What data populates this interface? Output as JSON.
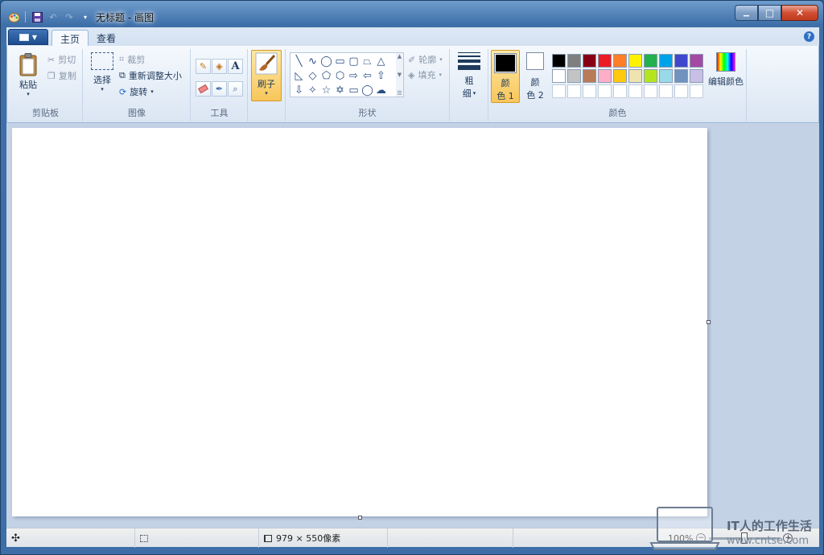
{
  "window": {
    "title": "无标题 - 画图"
  },
  "caption_buttons": {
    "minimize": "▁",
    "maximize": "□",
    "close": "✕"
  },
  "tabs": [
    {
      "label": "主页",
      "active": true
    },
    {
      "label": "查看",
      "active": false
    }
  ],
  "clipboard": {
    "paste": "粘贴",
    "cut": "剪切",
    "copy": "复制",
    "group": "剪贴板"
  },
  "image": {
    "select": "选择",
    "crop": "裁剪",
    "resize": "重新调整大小",
    "rotate": "旋转",
    "group": "图像"
  },
  "tools": {
    "group": "工具",
    "text_glyph": "A"
  },
  "brushes": {
    "label": "刷子"
  },
  "shapes": {
    "outline": "轮廓",
    "fill": "填充",
    "group": "形状"
  },
  "size": {
    "line1": "粗",
    "line2": "细"
  },
  "colors": {
    "color1_l1": "颜",
    "color1_l2": "色 1",
    "color2_l1": "颜",
    "color2_l2": "色 2",
    "edit": "编辑颜色",
    "group": "颜色",
    "color1": "#000000",
    "color2": "#ffffff",
    "palette": [
      "#000000",
      "#7f7f7f",
      "#880015",
      "#ed1c24",
      "#ff7f27",
      "#fff200",
      "#22b14c",
      "#00a2e8",
      "#3f48cc",
      "#a349a4",
      "#ffffff",
      "#c3c3c3",
      "#b97a57",
      "#ffaec9",
      "#ffc90e",
      "#efe4b0",
      "#b5e61d",
      "#99d9ea",
      "#7092be",
      "#c8bfe7",
      "#ffffff",
      "#ffffff",
      "#ffffff",
      "#ffffff",
      "#ffffff",
      "#ffffff",
      "#ffffff",
      "#ffffff",
      "#ffffff",
      "#ffffff"
    ]
  },
  "status": {
    "dimensions": "979 × 550像素",
    "zoom": "100%"
  },
  "watermark": {
    "title": "IT人的工作生活",
    "url": "www.cntse.com"
  }
}
